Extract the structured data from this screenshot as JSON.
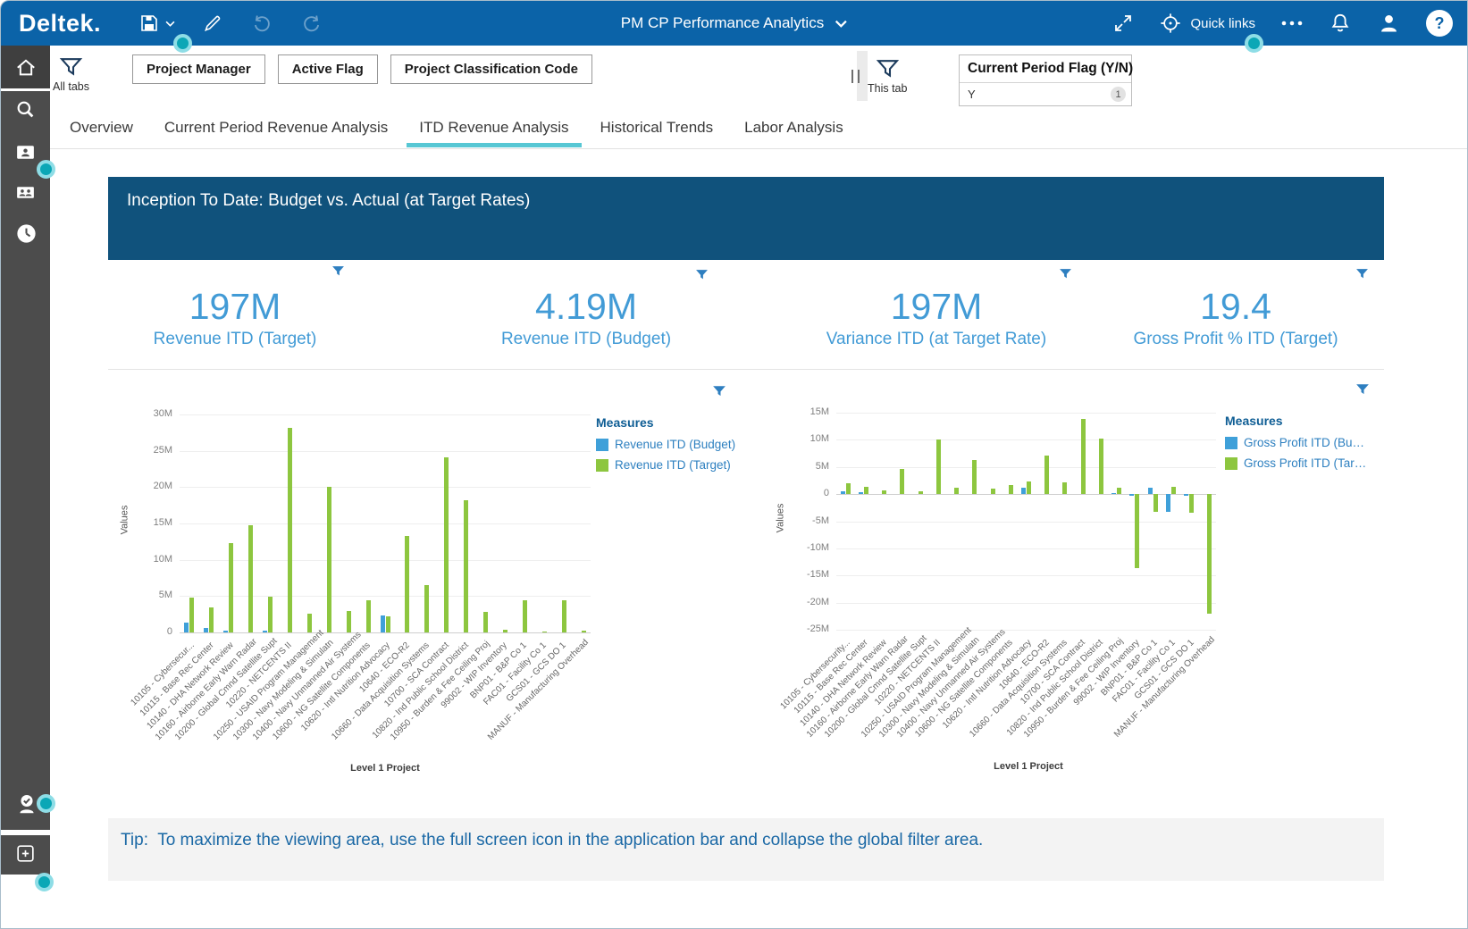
{
  "topbar": {
    "brand": "Deltek.",
    "title": "PM CP Performance Analytics",
    "quick_links_label": "Quick links",
    "help_glyph": "?"
  },
  "filter_bar": {
    "all_tabs_label": "All tabs",
    "chips": [
      {
        "label": "Project Manager"
      },
      {
        "label": "Active Flag"
      },
      {
        "label": "Project Classification Code"
      }
    ],
    "this_tab_label": "This tab",
    "field": {
      "label": "Current Period Flag (Y/N)",
      "value": "Y",
      "badge": "1"
    }
  },
  "tabs": [
    {
      "label": "Overview",
      "active": false
    },
    {
      "label": "Current Period Revenue Analysis",
      "active": false
    },
    {
      "label": "ITD Revenue Analysis",
      "active": true
    },
    {
      "label": "Historical Trends",
      "active": false
    },
    {
      "label": "Labor Analysis",
      "active": false
    }
  ],
  "section": {
    "band_title": "Inception To Date:  Budget vs. Actual (at Target Rates)"
  },
  "kpis": [
    {
      "value": "197M",
      "label": "Revenue ITD (Target)"
    },
    {
      "value": "4.19M",
      "label": "Revenue ITD (Budget)"
    },
    {
      "value": "197M",
      "label": "Variance ITD (at Target Rate)"
    },
    {
      "value": "19.4",
      "label": "Gross Profit % ITD (Target)"
    }
  ],
  "chart_data": [
    {
      "type": "bar",
      "title": "ITD Revenue: Budget vs Target by Level 1 Project",
      "xlabel": "Level 1 Project",
      "ylabel": "Values",
      "ylim": [
        0,
        30
      ],
      "ytick_step": 5,
      "unit": "M",
      "grid": true,
      "legend_position": "right",
      "legend_title": "Measures",
      "categories": [
        "10105 - Cybersecur...",
        "10115 - Base Rec Center",
        "10140 - DHA Network Review",
        "10160 - Airborne Early Warn Radar",
        "10200 - Global Cmnd Satellite Supt",
        "10220 - NETCENTS II",
        "10250 - USAID Program Management",
        "10300 - Navy Modeling & Simulatn",
        "10400 - Navy Unmanned Air Systems",
        "10600 - NG Satellite Components",
        "10620 - Intl Nutrition Advocacy",
        "10640 - ECO-R2",
        "10660 - Data Acquisition Systems",
        "10700 - SCA Contract",
        "10820 - Ind Public School District",
        "10950 - Burden & Fee Ceiling Proj",
        "99002 - WIP Inventory",
        "BNP01 - B&P Co 1",
        "FAC01 - Facility Co 1",
        "GCS01 - GCS DO 1",
        "MANUF - Manufacturing Overhead"
      ],
      "series": [
        {
          "name": "Revenue ITD (Budget)",
          "color": "#3fa0d9",
          "values": [
            1.4,
            0.6,
            0.3,
            0,
            0.2,
            0,
            0,
            0,
            0,
            0,
            2.3,
            0,
            0,
            0,
            0,
            0,
            0,
            0,
            0,
            0,
            0
          ]
        },
        {
          "name": "Revenue ITD (Target)",
          "color": "#8dc63f",
          "values": [
            4.8,
            3.4,
            12.3,
            14.8,
            4.9,
            28.2,
            2.6,
            20.1,
            2.9,
            4.4,
            2.2,
            13.3,
            6.5,
            24.1,
            18.2,
            2.8,
            0.4,
            4.4,
            0.1,
            4.4,
            0.3
          ]
        }
      ]
    },
    {
      "type": "bar",
      "title": "ITD Gross Profit: Budget vs Target by Level 1 Project",
      "xlabel": "Level 1 Project",
      "ylabel": "Values",
      "ylim": [
        -25,
        15
      ],
      "ytick_step": 5,
      "unit": "M",
      "grid": true,
      "legend_position": "right",
      "legend_title": "Measures",
      "categories": [
        "10105 - Cybersecurity...",
        "10115 - Base Rec Center",
        "10140 - DHA Network Review",
        "10160 - Airborne Early Warn Radar",
        "10200 - Global Cmnd Satellite Supt",
        "10220 - NETCENTS II",
        "10250 - USAID Program Management",
        "10300 - Navy Modeling & Simulatn",
        "10400 - Navy Unmanned Air Systems",
        "10600 - NG Satellite Components",
        "10620 - Intl Nutrition Advocacy",
        "10640 - ECO-R2",
        "10660 - Data Acquisition Systems",
        "10700 - SCA Contract",
        "10820 - Ind Public School District",
        "10950 - Burden & Fee Ceiling Proj",
        "99002 - WIP Inventory",
        "BNP01 - B&P Co 1",
        "FAC01 - Facility Co 1",
        "GCS01 - GCS DO 1",
        "MANUF - Manufacturing Overhead"
      ],
      "series": [
        {
          "name": "Gross Profit ITD (Bu…",
          "color": "#3fa0d9",
          "values": [
            0.5,
            0.3,
            0,
            0,
            0,
            0,
            0,
            0,
            0,
            0,
            1.2,
            0,
            0,
            0,
            0,
            0.2,
            -0.3,
            1.2,
            -3.2,
            -0.3,
            0
          ]
        },
        {
          "name": "Gross Profit ITD (Tar…",
          "color": "#8dc63f",
          "values": [
            2.0,
            1.3,
            0.7,
            4.7,
            0.5,
            10.1,
            1.2,
            6.3,
            1.0,
            1.6,
            2.4,
            7.1,
            2.1,
            13.8,
            10.2,
            1.2,
            -13.7,
            -3.2,
            1.3,
            -3.5,
            -22.0
          ]
        }
      ]
    }
  ],
  "tip": {
    "prefix": "Tip:",
    "text": "To maximize the viewing area, use the full screen icon in the application bar and collapse the global filter area."
  },
  "colors": {
    "topbar_blue": "#0b63a8",
    "band_blue": "#10527c",
    "kpi_text_blue": "#429bd6",
    "budget_bar_blue": "#3fa0d9",
    "target_bar_green": "#8dc63f",
    "tab_underline_cyan": "#57c7d4",
    "sidebar_gray": "#4c4c4c",
    "coach_dot_teal": "#0ba7b6"
  }
}
